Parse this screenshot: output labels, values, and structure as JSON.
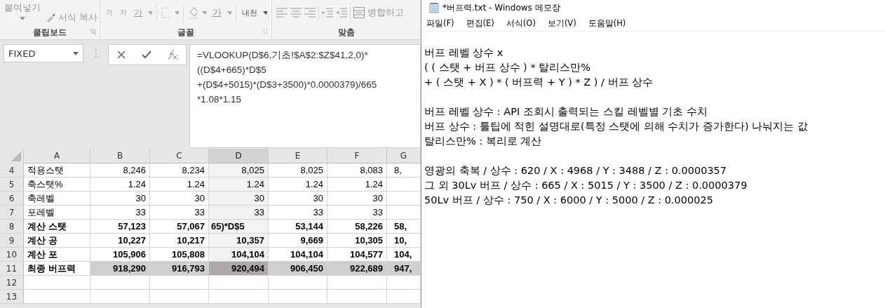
{
  "ribbon": {
    "paste_label": "붙여넣기",
    "format_painter": "서식 복사",
    "font_buttons": [
      "가",
      "가",
      "가"
    ],
    "font_color_label": "가",
    "phonetic_label": "내천",
    "merge_label": "병합하고",
    "groups": [
      "클립보드",
      "글꼴",
      "맞춤"
    ]
  },
  "formula_bar": {
    "name_box": "FIXED",
    "formula_lines": [
      "=VLOOKUP(D$6,기초!$A$2:$Z$41,2,0)*",
      "((D$4+665)*D$5",
      "+(D$4+5015)*(D$3+3500)*0.0000379)/665",
      "*1.08*1.15"
    ]
  },
  "sheet": {
    "columns": [
      {
        "label": "A",
        "selected": false
      },
      {
        "label": "B",
        "selected": false
      },
      {
        "label": "C",
        "selected": false
      },
      {
        "label": "D",
        "selected": true
      },
      {
        "label": "E",
        "selected": false
      },
      {
        "label": "F",
        "selected": false
      },
      {
        "label": "G",
        "selected": false
      }
    ],
    "rows": [
      {
        "number": "4",
        "bold": false,
        "total": false,
        "cells": [
          "적용스탯",
          "8,246",
          "8,234",
          "8,025",
          "8,025",
          "8,083",
          "8,"
        ]
      },
      {
        "number": "5",
        "bold": false,
        "total": false,
        "cells": [
          "축스탯%",
          "1.24",
          "1.24",
          "1.24",
          "1.24",
          "1.24",
          ""
        ]
      },
      {
        "number": "6",
        "bold": false,
        "total": false,
        "cells": [
          "축레벨",
          "30",
          "30",
          "30",
          "30",
          "30",
          ""
        ]
      },
      {
        "number": "7",
        "bold": false,
        "total": false,
        "cells": [
          "포레벨",
          "33",
          "33",
          "33",
          "33",
          "33",
          ""
        ]
      },
      {
        "number": "8",
        "bold": true,
        "total": false,
        "cells": [
          "계산 스탯",
          "57,123",
          "57,067",
          "65)*D$5",
          "53,144",
          "58,226",
          "58,"
        ]
      },
      {
        "number": "9",
        "bold": true,
        "total": false,
        "cells": [
          "계산 공",
          "10,227",
          "10,217",
          "10,357",
          "9,669",
          "10,305",
          "10,"
        ]
      },
      {
        "number": "10",
        "bold": true,
        "total": false,
        "cells": [
          "계산 포",
          "105,906",
          "105,808",
          "104,104",
          "104,104",
          "104,577",
          "104,"
        ]
      },
      {
        "number": "11",
        "bold": true,
        "total": true,
        "cells": [
          "최종 버프력",
          "918,290",
          "916,793",
          "920,494",
          "906,450",
          "922,689",
          "947,"
        ]
      },
      {
        "number": "12",
        "cells": [
          "",
          "",
          "",
          "",
          "",
          "",
          ""
        ]
      },
      {
        "number": "13",
        "cells": [
          "",
          "",
          "",
          "",
          "",
          "",
          ""
        ]
      }
    ]
  },
  "notepad": {
    "title": "*버프력.txt - Windows 메모장",
    "menu": [
      "파일(F)",
      "편집(E)",
      "서식(O)",
      "보기(V)",
      "도움말(H)"
    ],
    "paragraphs": [
      [
        "버프 레벨 상수 x",
        "( ( 스탯 + 버프 상수 ) * 탈리스만%",
        "+ ( 스탯 + X ) * ( 버프력 + Y ) * Z ) / 버프 상수"
      ],
      [
        "버프 레벨 상수 : API 조회시 출력되는 스킬 레벨별 기초 수치",
        "버프 상수 : 툴팁에 적힌 설명대로(특정 스탯에 의해 수치가 증가한다) 나눠지는 값",
        "탈리스만% : 복리로 계산"
      ],
      [
        "영광의 축복 / 상수 : 620 / X : 4968 / Y : 3488 / Z : 0.0000357",
        "그 외 30Lv 버프 / 상수 : 665 / X : 5015 / Y : 3500 / Z : 0.0000379",
        "50Lv 버프 / 상수 : 750 / X : 6000 / Y : 5000 / Z : 0.000025"
      ]
    ]
  }
}
